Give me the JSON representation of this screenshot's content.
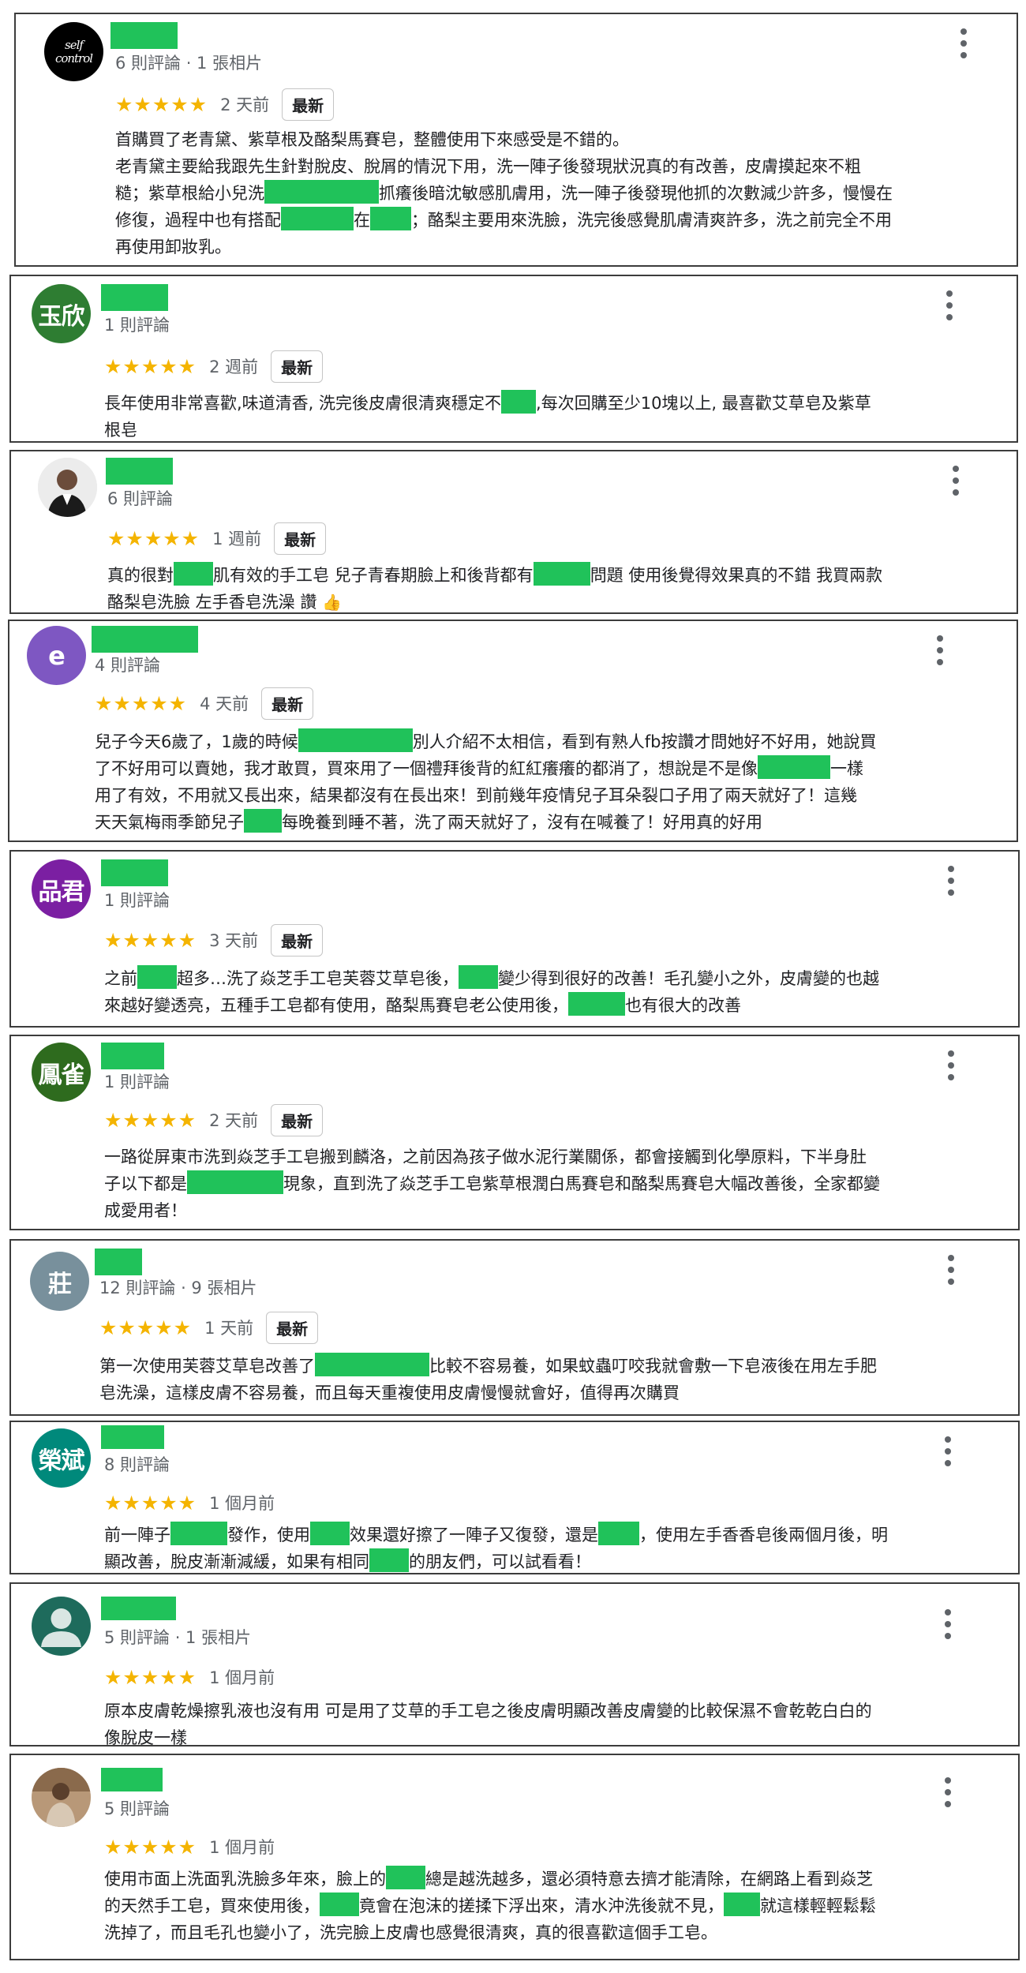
{
  "reviews": [
    {
      "meta": "6 則評論 · 1 張相片",
      "stars": "★★★★★",
      "time": "2 天前",
      "badge": "最新",
      "lines": [
        "首購買了老青黛、紫草根及酪梨馬賽皂，整體使用下來感受是不錯的。",
        "老青黛主要給我跟先生針對脫皮、脫屑的情況下用，洗一陣子後發現狀況真的有改善，皮膚摸起來不粗",
        "糙；紫草根給小兒洗",
        "抓癢後暗沈敏感肌膚用，洗一陣子後發現他抓的次數減少許多，慢慢在",
        "修復，過程中也有搭配",
        "在",
        "；酪梨主要用來洗臉，洗完後感覺肌膚清爽許多，洗之前完全不用",
        "再使用卸妝乳。"
      ]
    },
    {
      "avatar": "玉欣",
      "meta": "1 則評論",
      "stars": "★★★★★",
      "time": "2 週前",
      "badge": "最新",
      "lines": [
        "長年使用非常喜歡,味道清香, 洗完後皮膚很清爽穩定不",
        ",每次回購至少10塊以上, 最喜歡艾草皂及紫草",
        "根皂"
      ]
    },
    {
      "meta": "6 則評論",
      "stars": "★★★★★",
      "time": "1 週前",
      "badge": "最新",
      "lines": [
        "真的很對",
        "肌有效的手工皂 兒子青春期臉上和後背都有",
        "問題 使用後覺得效果真的不錯 我買兩款",
        "酪梨皂洗臉 左手香皂洗澡 讚"
      ]
    },
    {
      "avatar": "e",
      "meta": "4 則評論",
      "stars": "★★★★★",
      "time": "4 天前",
      "badge": "最新",
      "lines": [
        "兒子今天6歲了，1歲的時候",
        "別人介紹不太相信，看到有熟人fb按讚才問她好不好用，她說買",
        "了不好用可以賣她，我才敢買，買來用了一個禮拜後背的紅紅癢癢的都消了，想說是不是像",
        "一樣",
        "用了有效，不用就又長出來，結果都沒有在長出來！到前幾年疫情兒子耳朵裂口子用了兩天就好了！這幾",
        "天天氣梅雨季節兒子",
        "每晚養到睡不著，洗了兩天就好了，沒有在喊養了！好用真的好用"
      ]
    },
    {
      "avatar": "品君",
      "meta": "1 則評論",
      "stars": "★★★★★",
      "time": "3 天前",
      "badge": "最新",
      "lines": [
        "之前",
        "超多…洗了焱芝手工皂芙蓉艾草皂後，",
        "變少得到很好的改善！毛孔變小之外，皮膚變的也越",
        "來越好變透亮，五種手工皂都有使用，酪梨馬賽皂老公使用後，",
        "也有很大的改善"
      ]
    },
    {
      "avatar": "鳳雀",
      "meta": "1 則評論",
      "stars": "★★★★★",
      "time": "2 天前",
      "badge": "最新",
      "lines": [
        "一路從屏東市洗到焱芝手工皂搬到麟洛，之前因為孩子做水泥行業關係，都會接觸到化學原料，下半身肚",
        "子以下都是",
        "現象，直到洗了焱芝手工皂紫草根潤白馬賽皂和酪梨馬賽皂大幅改善後，全家都變",
        "成愛用者！"
      ]
    },
    {
      "avatar": "莊",
      "meta": "12 則評論 · 9 張相片",
      "stars": "★★★★★",
      "time": "1 天前",
      "badge": "最新",
      "lines": [
        "第一次使用芙蓉艾草皂改善了",
        "比較不容易養，如果蚊蟲叮咬我就會敷一下皂液後在用左手肥",
        "皂洗澡，這樣皮膚不容易養，而且每天重複使用皮膚慢慢就會好，值得再次購買"
      ]
    },
    {
      "avatar": "榮斌",
      "meta": "8 則評論",
      "stars": "★★★★★",
      "time": "1 個月前",
      "lines": [
        "前一陣子",
        "發作，使用",
        "效果還好擦了一陣子又復發，還是",
        "，使用左手香香皂後兩個月後，明",
        "顯改善，脫皮漸漸減緩，如果有相同",
        "的朋友們，可以試看看！"
      ]
    },
    {
      "meta": "5 則評論 · 1 張相片",
      "stars": "★★★★★",
      "time": "1 個月前",
      "lines": [
        "原本皮膚乾燥擦乳液也沒有用 可是用了艾草的手工皂之後皮膚明顯改善皮膚變的比較保濕不會乾乾白白的",
        "像脫皮一樣"
      ]
    },
    {
      "meta": "5 則評論",
      "stars": "★★★★★",
      "time": "1 個月前",
      "lines": [
        "使用市面上洗面乳洗臉多年來，臉上的",
        "總是越洗越多，還必須特意去擠才能清除，在網路上看到焱芝",
        "的天然手工皂，買來使用後，",
        "竟會在泡沫的搓揉下浮出來，清水沖洗後就不見，",
        "就這樣輕輕鬆鬆",
        "洗掉了，而且毛孔也變小了，洗完臉上皮膚也感覺很清爽，真的很喜歡這個手工皂。"
      ]
    }
  ],
  "self_avatar": {
    "line1": "self",
    "line2": "control"
  },
  "thumb_emoji": "👍",
  "colors": {
    "accent_green": "#20c25a",
    "star": "#f4b400"
  }
}
